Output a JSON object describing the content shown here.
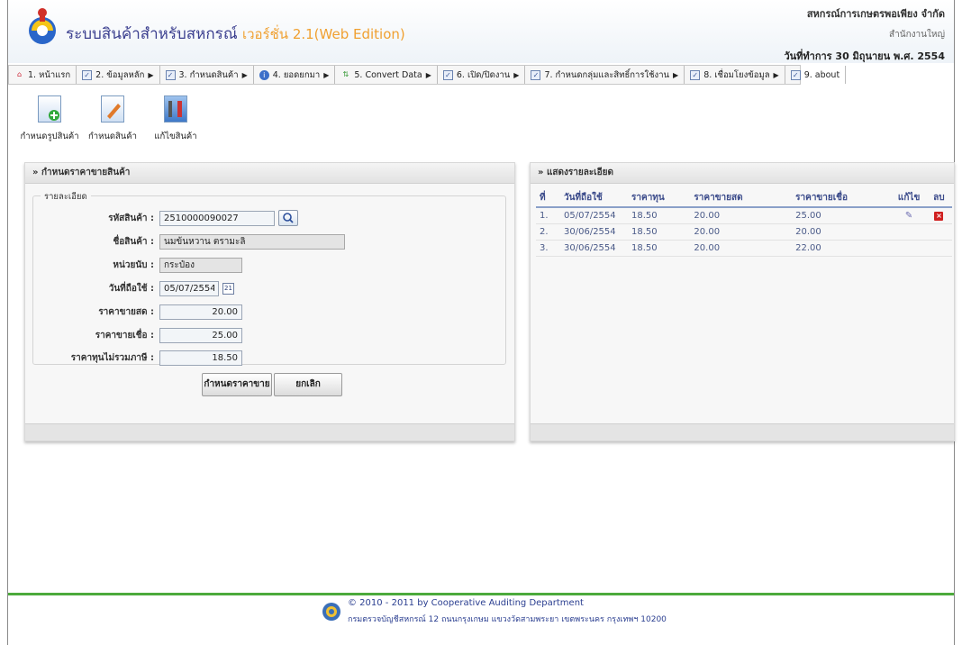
{
  "header": {
    "app_title": "ระบบสินค้าสำหรับสหกรณ์",
    "version": "เวอร์ชั่น 2.1(Web Edition)",
    "org_name": "สหกรณ์การเกษตรพอเพียง จำกัด",
    "branch": "สำนักงานใหญ่",
    "work_date": "วันที่ทำการ 30 มิถุนายน พ.ศ. 2554"
  },
  "menu": [
    {
      "label": "1. หน้าแรก",
      "icon": "home-icon",
      "arrow": ""
    },
    {
      "label": "2. ข้อมูลหลัก",
      "icon": "checklist-icon",
      "arrow": "▶"
    },
    {
      "label": "3. กำหนดสินค้า",
      "icon": "checklist-icon",
      "arrow": "▶"
    },
    {
      "label": "4. ยอดยกมา",
      "icon": "info-icon",
      "arrow": "▶"
    },
    {
      "label": "5. Convert Data",
      "icon": "convert-icon",
      "arrow": "▶"
    },
    {
      "label": "6. เปิด/ปิดงาน",
      "icon": "checklist-icon",
      "arrow": "▶"
    },
    {
      "label": "7. กำหนดกลุ่มและสิทธิ์การใช้งาน",
      "icon": "checklist-icon",
      "arrow": "▶"
    },
    {
      "label": "8. เชื่อมโยงข้อมูล",
      "icon": "checklist-icon",
      "arrow": "▶"
    },
    {
      "label": "9. about",
      "icon": "checklist-icon",
      "arrow": ""
    }
  ],
  "toolbar": [
    {
      "label": "กำหนดรูปสินค้า",
      "icon": "add-product-image-icon"
    },
    {
      "label": "กำหนดสินค้า",
      "icon": "edit-product-icon"
    },
    {
      "label": "แก้ไขสินค้า",
      "icon": "tools-icon"
    }
  ],
  "form": {
    "title": "» กำหนดราคาขายสินค้า",
    "legend": "รายละเอียด",
    "product_code_label": "รหัสสินค้า :",
    "product_code": "2510000090027",
    "product_name_label": "ชื่อสินค้า :",
    "product_name": "นมข้นหวาน ตรามะลิ",
    "unit_label": "หน่วยนับ :",
    "unit": "กระป๋อง",
    "effective_date_label": "วันที่ถือใช้ :",
    "effective_date": "05/07/2554",
    "cash_price_label": "ราคาขายสด :",
    "cash_price": "20.00",
    "credit_price_label": "ราคาขายเชื่อ :",
    "credit_price": "25.00",
    "cost_label": "ราคาทุนไม่รวมภาษี :",
    "cost": "18.50",
    "submit_label": "กำหนดราคาขาย",
    "cancel_label": "ยกเลิก",
    "calendar_glyph": "21"
  },
  "details": {
    "title": "» แสดงรายละเอียด",
    "columns": [
      "ที่",
      "วันที่ถือใช้",
      "ราคาทุน",
      "ราคาขายสด",
      "ราคาขายเชื่อ",
      "แก้ไข",
      "ลบ"
    ],
    "rows": [
      {
        "no": "1.",
        "date": "05/07/2554",
        "cost": "18.50",
        "cash": "20.00",
        "credit": "25.00",
        "editable": true
      },
      {
        "no": "2.",
        "date": "30/06/2554",
        "cost": "18.50",
        "cash": "20.00",
        "credit": "20.00",
        "editable": false
      },
      {
        "no": "3.",
        "date": "30/06/2554",
        "cost": "18.50",
        "cash": "20.00",
        "credit": "22.00",
        "editable": false
      }
    ]
  },
  "footer": {
    "copyright": "© 2010 - 2011  by Cooperative Auditing Department",
    "address": "กรมตรวจบัญชีสหกรณ์ 12 ถนนกรุงเกษม แขวงวัดสามพระยา เขตพระนคร กรุงเทพฯ 10200"
  },
  "colors": {
    "title_blue": "#3b3f8f",
    "version_orange": "#f0a030",
    "footer_green": "#4caa3c",
    "delete_red": "#d02020"
  }
}
